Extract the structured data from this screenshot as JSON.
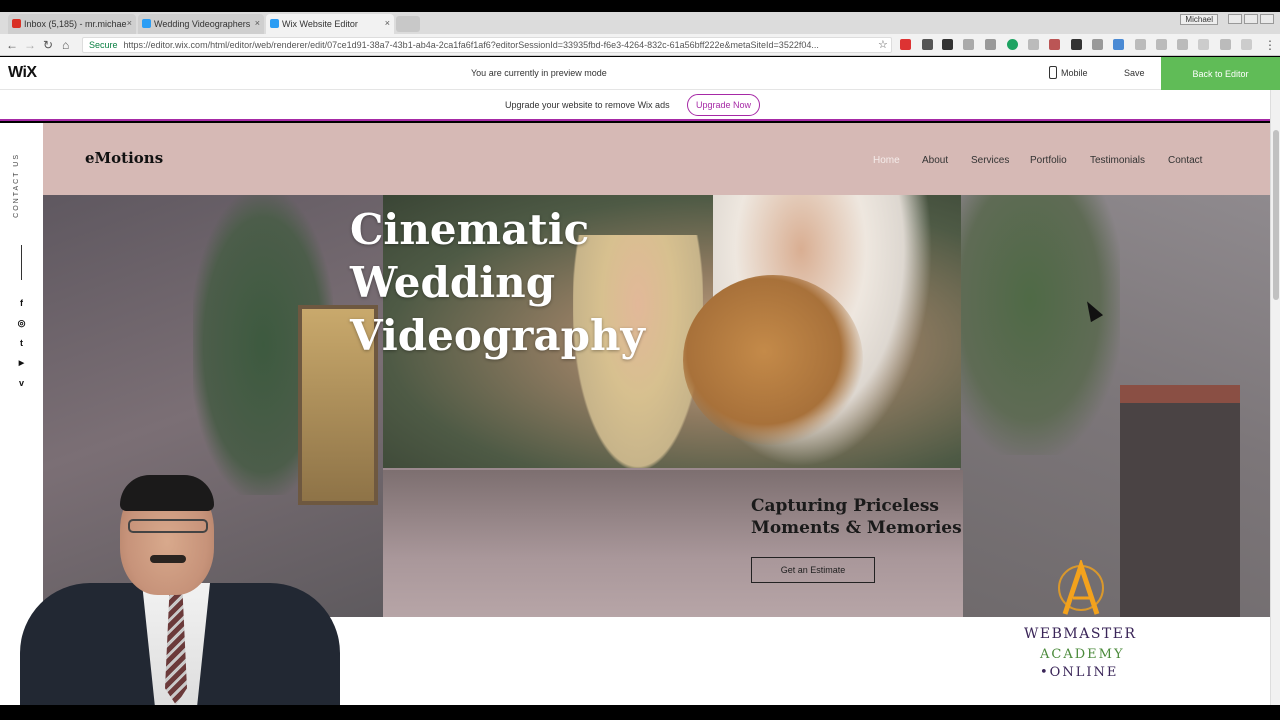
{
  "browser": {
    "tabs": [
      {
        "title": "Inbox (5,185) - mr.michae",
        "favicon_color": "#d93025"
      },
      {
        "title": "Wedding Videographers",
        "favicon_color": "#2a9df4"
      },
      {
        "title": "Wix Website Editor",
        "favicon_color": "#2a9df4"
      }
    ],
    "close_glyph": "×",
    "secure_label": "Secure",
    "url": "https://editor.wix.com/html/editor/web/renderer/edit/07ce1d91-38a7-43b1-ab4a-2ca1fa6f1af6?editorSessionId=33935fbd-f6e3-4264-832c-61a56bff222e&metaSiteId=3522f04...",
    "back_glyph": "←",
    "forward_glyph": "→",
    "reload_glyph": "↻",
    "home_glyph": "⌂",
    "star_glyph": "☆",
    "menu_glyph": "⋮",
    "user_label": "Michael"
  },
  "wix_bar": {
    "logo": "WiX",
    "preview_text": "You are currently in preview mode",
    "mobile_label": "Mobile",
    "save_label": "Save",
    "back_label": "Back to Editor"
  },
  "upgrade_bar": {
    "message": "Upgrade your website to remove Wix ads",
    "button": "Upgrade Now"
  },
  "site": {
    "rail": {
      "contact_label": "CONTACT US",
      "social": [
        {
          "glyph": "f",
          "icon": "facebook-icon"
        },
        {
          "glyph": "◎",
          "icon": "instagram-icon"
        },
        {
          "glyph": "t",
          "icon": "twitter-icon"
        },
        {
          "glyph": "▶",
          "icon": "youtube-icon"
        },
        {
          "glyph": "v",
          "icon": "vimeo-icon"
        }
      ]
    },
    "brand": "eMotions",
    "nav": [
      "Home",
      "About",
      "Services",
      "Portfolio",
      "Testimonials",
      "Contact"
    ],
    "hero": {
      "title_line1": "Cinematic",
      "title_line2": "Wedding",
      "title_line3": "Videography",
      "tagline_line1": "Capturing Priceless",
      "tagline_line2": "Moments & Memories",
      "cta": "Get an Estimate"
    }
  },
  "overlay": {
    "academy_line1": "WEBMASTER",
    "academy_line2": "ACADEMY",
    "academy_line3": "•ONLINE",
    "logo_color": "#f3a21c"
  }
}
